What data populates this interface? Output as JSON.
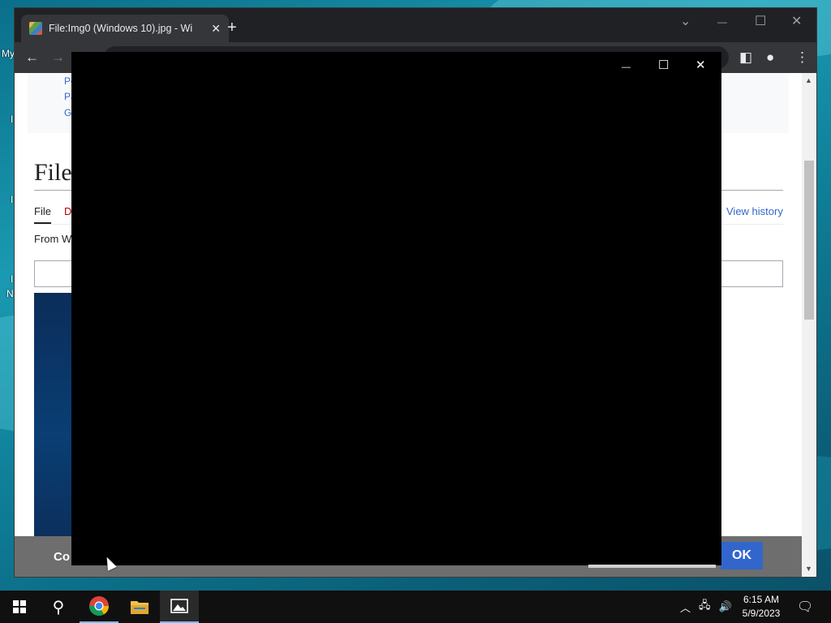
{
  "desktop": {
    "labels": [
      "My",
      "I",
      "I",
      "I",
      "N"
    ]
  },
  "browser": {
    "tab_title": "File:Img0 (Windows 10).jpg - Wi",
    "tab_close": "✕",
    "new_tab": "+",
    "window_controls": {
      "tab_search": "⌄",
      "minimize": "—",
      "maximize": "☐",
      "close": "✕"
    },
    "nav": {
      "back": "←",
      "forward": "→"
    },
    "toolbar_icons": {
      "side_panel": "◧",
      "profile": "●",
      "menu": "⋮"
    }
  },
  "page": {
    "sidebar_links": [
      "Perm",
      "Page",
      "Get s"
    ],
    "heading": "File",
    "tab_file": "File",
    "tab_discussion": "D",
    "view_history": "View history",
    "from": "From W",
    "scroll_up": "▲",
    "scroll_down": "▼"
  },
  "cookie_banner": {
    "text": "Co",
    "ok_label": "OK"
  },
  "photos_window": {
    "minimize": "—",
    "maximize": "☐",
    "close": "✕"
  },
  "taskbar": {
    "search_icon": "⚲",
    "tray_chevron": "︿",
    "network": "🖧",
    "volume": "🔊",
    "time": "6:15 AM",
    "date": "5/9/2023",
    "notification": "🗨"
  },
  "colors": {
    "link": "#3366cc",
    "ok_button": "#3366cc",
    "chrome_dark": "#202124",
    "taskbar": "#101010"
  }
}
